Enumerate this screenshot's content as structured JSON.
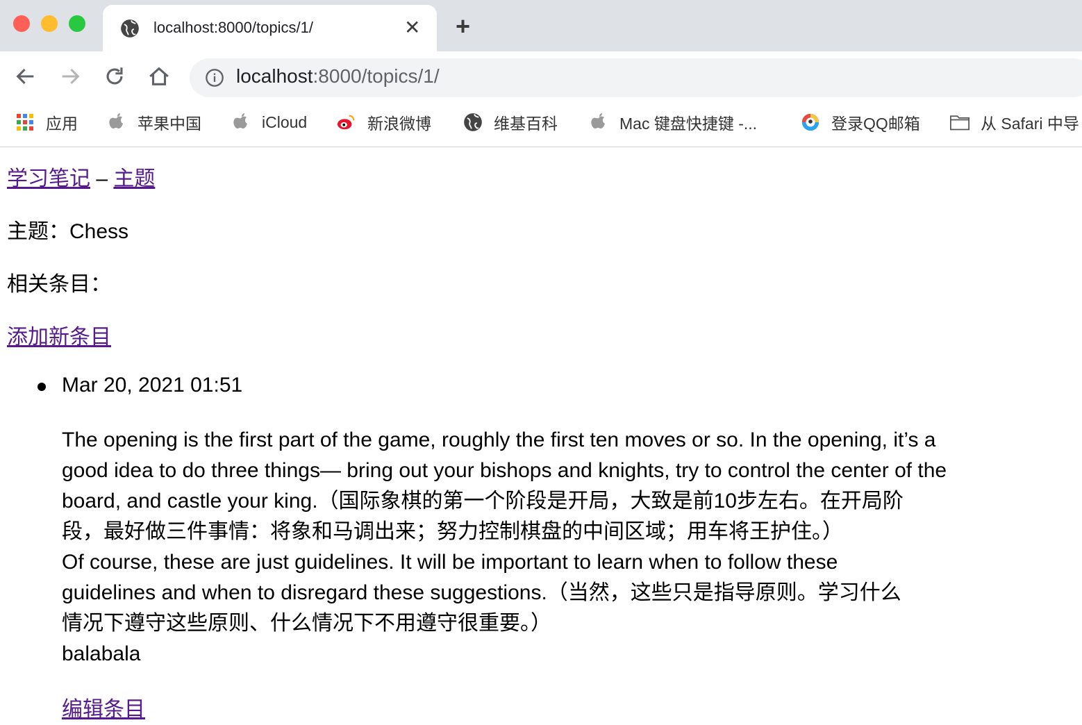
{
  "browser": {
    "tab_title": "localhost:8000/topics/1/",
    "tab_close": "✕",
    "new_tab": "+",
    "url_host": "localhost",
    "url_path": ":8000/topics/1/",
    "bookmarks": [
      {
        "label": "应用",
        "icon": "apps-grid-icon"
      },
      {
        "label": "苹果中国",
        "icon": "apple-icon"
      },
      {
        "label": "iCloud",
        "icon": "apple-icon"
      },
      {
        "label": "新浪微博",
        "icon": "weibo-icon"
      },
      {
        "label": "维基百科",
        "icon": "wikipedia-icon"
      },
      {
        "label": "Mac 键盘快捷键 -...",
        "icon": "apple-icon"
      },
      {
        "label": "登录QQ邮箱",
        "icon": "qq-mail-icon"
      },
      {
        "label": "从 Safari 中导",
        "icon": "folder-icon"
      }
    ]
  },
  "page": {
    "breadcrumb_home": "学习笔记",
    "breadcrumb_sep": " – ",
    "breadcrumb_topics": "主题",
    "topic_line": "主题：Chess",
    "entries_heading": "相关条目：",
    "add_entry": "添加新条目",
    "entry": {
      "date": "Mar 20, 2021 01:51",
      "lines": [
        "The opening is the first part of the game, roughly the first ten moves or so. In the opening, it’s a",
        "good idea to do three things— bring out your bishops and knights, try to control the center of the",
        "board, and castle your king.（国际象棋的第一个阶段是开局，大致是前10步左右。在开局阶",
        "段，最好做三件事情：将象和马调出来；努力控制棋盘的中间区域；用车将王护住。）",
        "Of course, these are just guidelines. It will be important to learn when to follow these",
        "guidelines and when to disregard these suggestions.（当然，这些只是指导原则。学习什么",
        "情况下遵守这些原则、什么情况下不用遵守很重要。）",
        "balabala"
      ],
      "edit": "编辑条目"
    }
  },
  "colors": {
    "link": "#551a8b",
    "tabbar": "#dee1e6",
    "omnibox": "#f1f3f4"
  }
}
